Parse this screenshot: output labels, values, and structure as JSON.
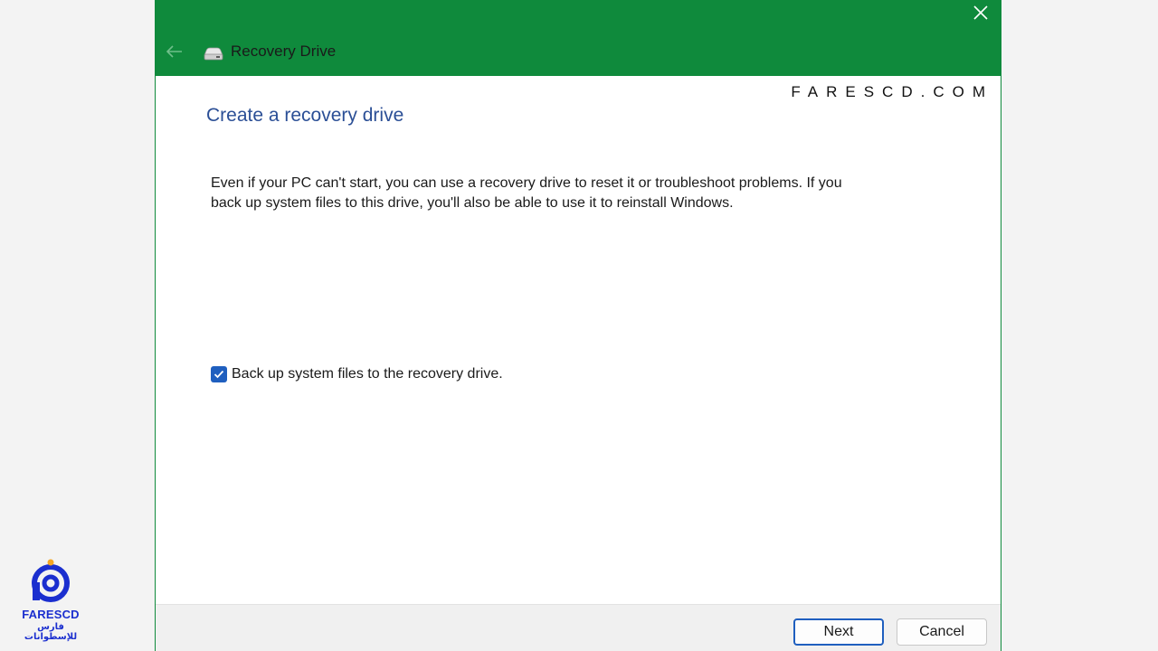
{
  "window": {
    "title": "Recovery Drive",
    "icons": {
      "back": "back-arrow-icon",
      "drive": "drive-icon",
      "close": "close-icon"
    }
  },
  "watermark": "FARESCD.COM",
  "page": {
    "heading": "Create a recovery drive",
    "description": "Even if your PC can't start, you can use a recovery drive to reset it or troubleshoot problems. If you back up system files to this drive, you'll also be able to use it to reinstall Windows.",
    "backup_checkbox": {
      "label": "Back up system files to the recovery drive.",
      "checked": true
    }
  },
  "footer": {
    "next_label": "Next",
    "cancel_label": "Cancel"
  },
  "logo": {
    "name": "FARESCD",
    "subtitle": "فارس للإسطوانات"
  },
  "colors": {
    "titlebar": "#0f8a3c",
    "accent": "#1f5fbf",
    "heading": "#2b4f96",
    "logo": "#1b2fcf"
  }
}
